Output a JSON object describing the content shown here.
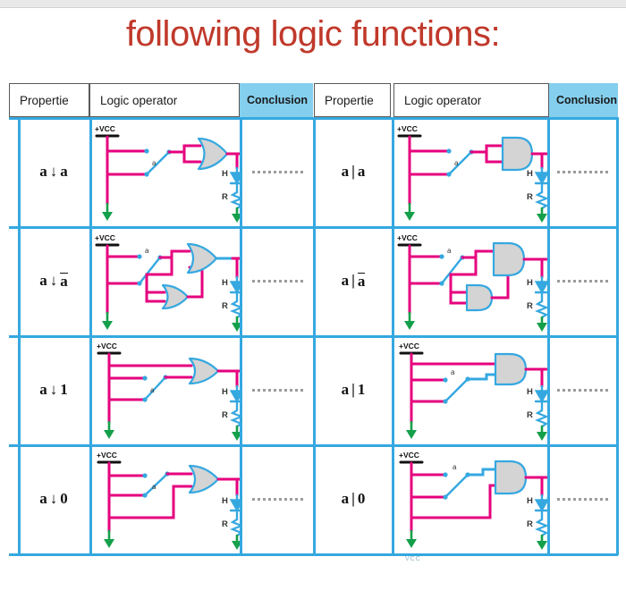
{
  "slide": {
    "title": "following logic functions:",
    "title_color": "#c0392b"
  },
  "theme": {
    "grid_blue": "#35a8e0",
    "header_fill": "#84cfee",
    "wire_magenta": "#e6007e",
    "wire_blue": "#35a8e0",
    "ground_green": "#14a04a",
    "gate_fill": "#c9c9c9",
    "header_border": "#595959"
  },
  "table": {
    "headers": [
      {
        "label": "Propertie",
        "kind": "plain"
      },
      {
        "label": "Logic operator",
        "kind": "plain"
      },
      {
        "label": "Conclusion",
        "kind": "highlight"
      },
      {
        "label": "Propertie",
        "kind": "plain"
      },
      {
        "label": "Logic operator",
        "kind": "plain"
      },
      {
        "label": "Conclusion",
        "kind": "highlight"
      }
    ],
    "rows": [
      {
        "left_propertie": {
          "lhs": "a",
          "op": "↓",
          "rhs": "a",
          "rhs_overline": false
        },
        "left_circuit": "nor-a-a",
        "left_conclusion": "..........",
        "right_propertie": {
          "lhs": "a",
          "op": "|",
          "rhs": "a",
          "rhs_overline": false
        },
        "right_circuit": "nand-a-a",
        "right_conclusion": ".........."
      },
      {
        "left_propertie": {
          "lhs": "a",
          "op": "↓",
          "rhs": "a",
          "rhs_overline": true
        },
        "left_circuit": "nor-a-nota",
        "left_conclusion": "..........",
        "right_propertie": {
          "lhs": "a",
          "op": "|",
          "rhs": "a",
          "rhs_overline": true
        },
        "right_circuit": "nand-a-nota",
        "right_conclusion": ".........."
      },
      {
        "left_propertie": {
          "lhs": "a",
          "op": "↓",
          "rhs": "1",
          "rhs_overline": false
        },
        "left_circuit": "nor-a-1",
        "left_conclusion": "..........",
        "right_propertie": {
          "lhs": "a",
          "op": "|",
          "rhs": "1",
          "rhs_overline": false
        },
        "right_circuit": "nand-a-1",
        "right_conclusion": ".........."
      },
      {
        "left_propertie": {
          "lhs": "a",
          "op": "↓",
          "rhs": "0",
          "rhs_overline": false
        },
        "left_circuit": "nor-a-0",
        "left_conclusion": "..........",
        "right_propertie": {
          "lhs": "a",
          "op": "|",
          "rhs": "0",
          "rhs_overline": false
        },
        "right_circuit": "nand-a-0",
        "right_conclusion": ".........."
      }
    ]
  },
  "circuit_labels": {
    "supply": "+VCC",
    "switch": "a",
    "lamp": "H",
    "resistor": "R"
  }
}
